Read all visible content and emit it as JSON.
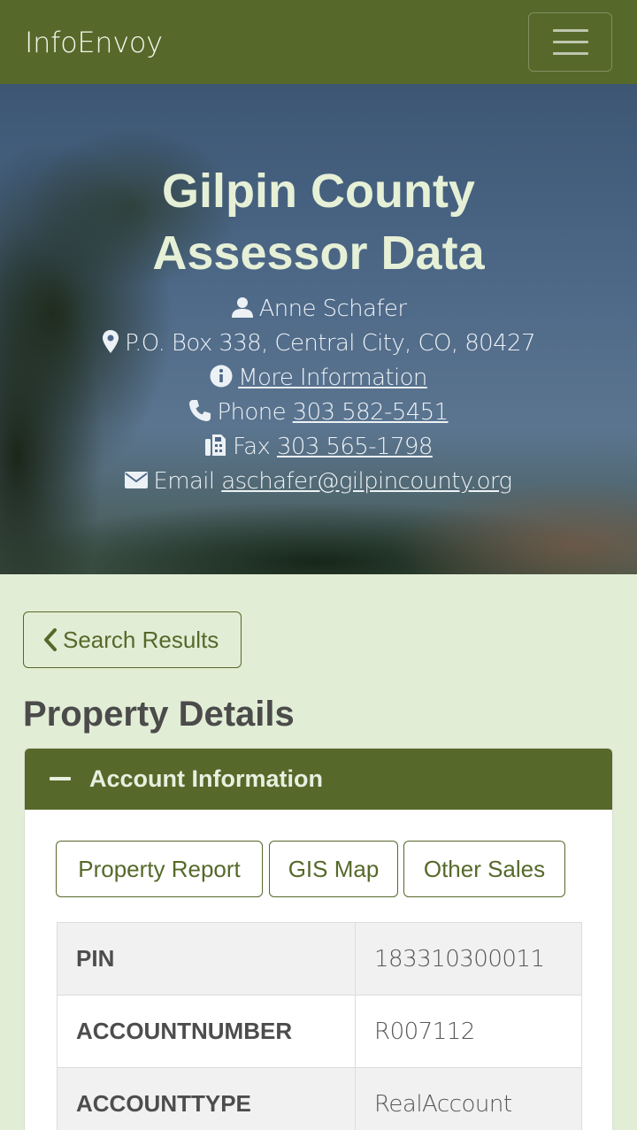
{
  "navbar": {
    "brand": "InfoEnvoy",
    "toggle_icon": "hamburger-icon"
  },
  "hero": {
    "title_line1": "Gilpin County",
    "title_line2": "Assessor Data",
    "contact_name": "Anne Schafer",
    "address": "P.O. Box 338, Central City, CO, 80427",
    "more_info_link": "More Information",
    "phone_label": "Phone",
    "phone_number": "303 582-5451",
    "fax_label": "Fax",
    "fax_number": "303 565-1798",
    "email_label": "Email",
    "email_address": "aschafer@gilpincounty.org"
  },
  "back_button": {
    "label": "Search Results"
  },
  "page": {
    "section_title": "Property Details"
  },
  "account_card": {
    "title": "Account Information",
    "buttons": [
      "Property Report",
      "GIS Map",
      "Other Sales"
    ],
    "rows": [
      {
        "key": "PIN",
        "value": "183310300011"
      },
      {
        "key": "ACCOUNTNUMBER",
        "value": "R007112"
      },
      {
        "key": "ACCOUNTTYPE",
        "value": "RealAccount"
      }
    ]
  },
  "colors": {
    "brand_green": "#56692a",
    "page_background": "#e2edd6",
    "hero_title": "#e6f0d6"
  }
}
